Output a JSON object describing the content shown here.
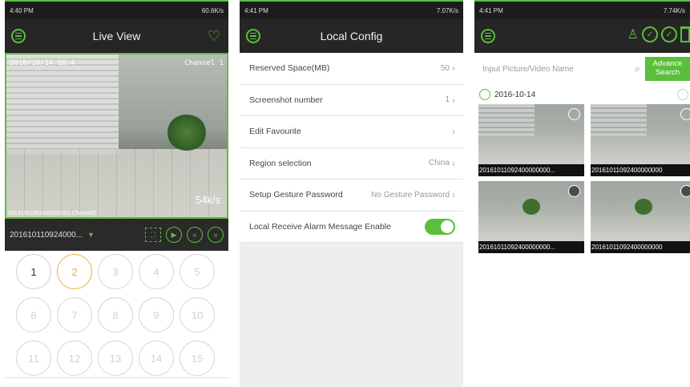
{
  "screen1": {
    "status_time": "4:40 PM",
    "status_right": "60.6K/s",
    "title": "Live View",
    "video": {
      "timestamp": "2016/10/14 16:4",
      "channel": "Channel 1",
      "rate": "54k/s",
      "camera_label": "20141011092400000001-Channel2"
    },
    "control": {
      "device": "201610110924000..."
    },
    "channels": [
      "1",
      "2",
      "3",
      "4",
      "5",
      "6",
      "7",
      "8",
      "9",
      "10",
      "11",
      "12",
      "13",
      "14",
      "15"
    ]
  },
  "screen2": {
    "status_time": "4:41 PM",
    "status_right": "7.07K/s",
    "title": "Local Config",
    "rows": [
      {
        "label": "Reserved Space(MB)",
        "value": "50"
      },
      {
        "label": "Screenshot number",
        "value": "1"
      },
      {
        "label": "Edit Favourite",
        "value": ""
      },
      {
        "label": "Region selection",
        "value": "China"
      },
      {
        "label": "Setup Gesture Password",
        "value": "No Gesture Password"
      },
      {
        "label": "Local Receive Alarm Message Enable",
        "value": ""
      }
    ]
  },
  "screen3": {
    "status_time": "4:41 PM",
    "status_right": "7.74K/s",
    "search_placeholder": "Input Picture/Video Name",
    "advance_line1": "Advance",
    "advance_line2": "Search",
    "date": "2016-10-14",
    "thumbs": [
      "20161011092400000000...",
      "20161011092400000000",
      "20161011092400000000...",
      "20161011092400000000"
    ]
  },
  "colors": {
    "accent": "#5bbf3c",
    "bar": "#262626",
    "selected_channel": "#e4b53a"
  }
}
